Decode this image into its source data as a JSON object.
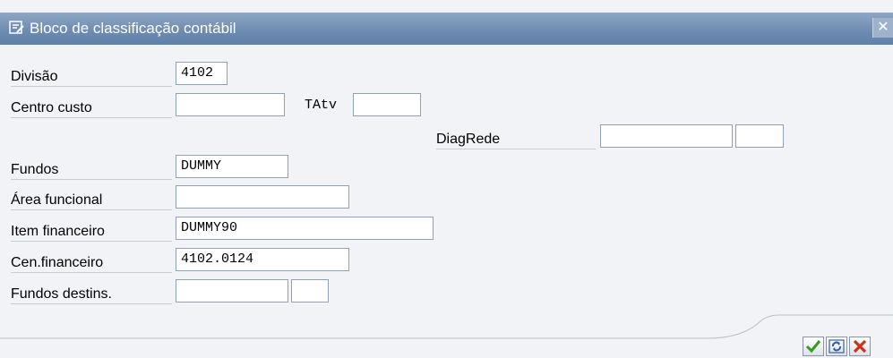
{
  "dialog": {
    "title": "Bloco de classificação contábil"
  },
  "fields": {
    "divisao": {
      "label": "Divisão",
      "value": "4102"
    },
    "centro_custo": {
      "label": "Centro custo",
      "value": ""
    },
    "tatv": {
      "label": "TAtv",
      "value": ""
    },
    "diagrede": {
      "label": "DiagRede",
      "value": "",
      "value2": ""
    },
    "fundos": {
      "label": "Fundos",
      "value": "DUMMY"
    },
    "area_funcional": {
      "label": "Área funcional",
      "value": ""
    },
    "item_financeiro": {
      "label": "Item financeiro",
      "value": "DUMMY90"
    },
    "cen_financeiro": {
      "label": "Cen.financeiro",
      "value": "4102.0124"
    },
    "fundos_destins": {
      "label": "Fundos destins.",
      "value": "",
      "value2": ""
    }
  },
  "buttons": {
    "continue_icon": "checkmark-icon",
    "refresh_icon": "refresh-icon",
    "cancel_icon": "cancel-icon"
  }
}
